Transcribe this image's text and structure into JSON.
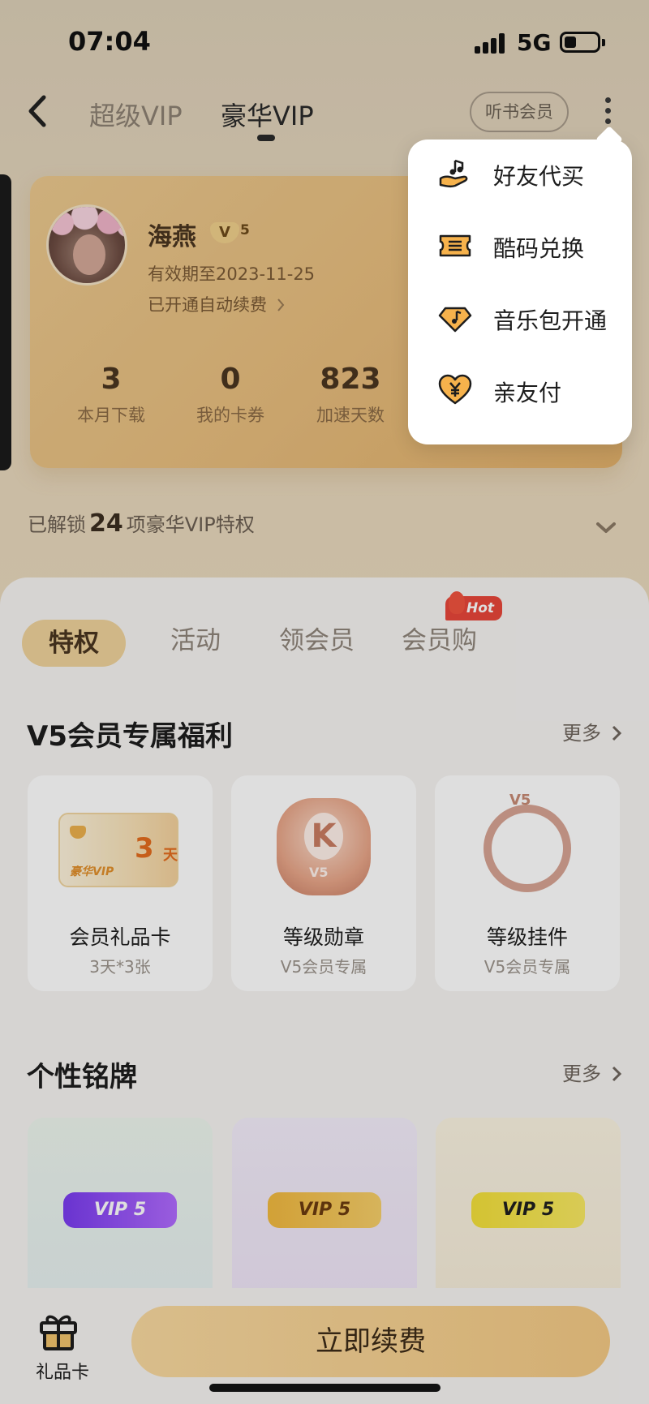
{
  "status_bar": {
    "time": "07:04",
    "network": "5G"
  },
  "nav": {
    "tabs": [
      {
        "label": "超级VIP"
      },
      {
        "label": "豪华VIP"
      }
    ],
    "audiobook_label": "听书会员"
  },
  "member_card": {
    "name": "海燕",
    "level_letter": "V",
    "level_number": "5",
    "expiry": "有效期至2023-11-25",
    "auto_renew": "已开通自动续费",
    "stats": [
      {
        "value": "3",
        "label": "本月下载"
      },
      {
        "value": "0",
        "label": "我的卡券"
      },
      {
        "value": "823",
        "label": "加速天数"
      }
    ]
  },
  "unlock": {
    "prefix": "已解锁",
    "count": "24",
    "suffix": "项豪华VIP特权"
  },
  "segments": {
    "tabs": [
      {
        "label": "特权"
      },
      {
        "label": "活动"
      },
      {
        "label": "领会员"
      },
      {
        "label": "会员购"
      }
    ],
    "hot_badge": "Hot"
  },
  "benefits": {
    "title": "V5会员专属福利",
    "more": "更多",
    "items": [
      {
        "title": "会员礼品卡",
        "subtitle": "3天*3张",
        "art_days": "3",
        "art_unit": "天",
        "art_brand": "豪华VIP"
      },
      {
        "title": "等级勋章",
        "subtitle": "V5会员专属",
        "art_letter": "K",
        "art_level": "V5"
      },
      {
        "title": "等级挂件",
        "subtitle": "V5会员专属",
        "art_level": "V5"
      }
    ]
  },
  "nameplates": {
    "title": "个性铭牌",
    "more": "更多",
    "items": [
      {
        "text": "VIP 5"
      },
      {
        "text": "VIP 5"
      },
      {
        "text": "VIP 5"
      }
    ]
  },
  "bottom_bar": {
    "gift_label": "礼品卡",
    "renew_label": "立即续费"
  },
  "popup_menu": {
    "items": [
      {
        "label": "好友代买",
        "icon": "hand-music-icon"
      },
      {
        "label": "酷码兑换",
        "icon": "ticket-icon"
      },
      {
        "label": "音乐包开通",
        "icon": "diamond-note-icon"
      },
      {
        "label": "亲友付",
        "icon": "heart-yen-icon"
      }
    ]
  },
  "colors": {
    "accent_gold": "#efd39b",
    "hot_red": "#e9473a",
    "menu_icon_orange": "#f0a04a"
  }
}
